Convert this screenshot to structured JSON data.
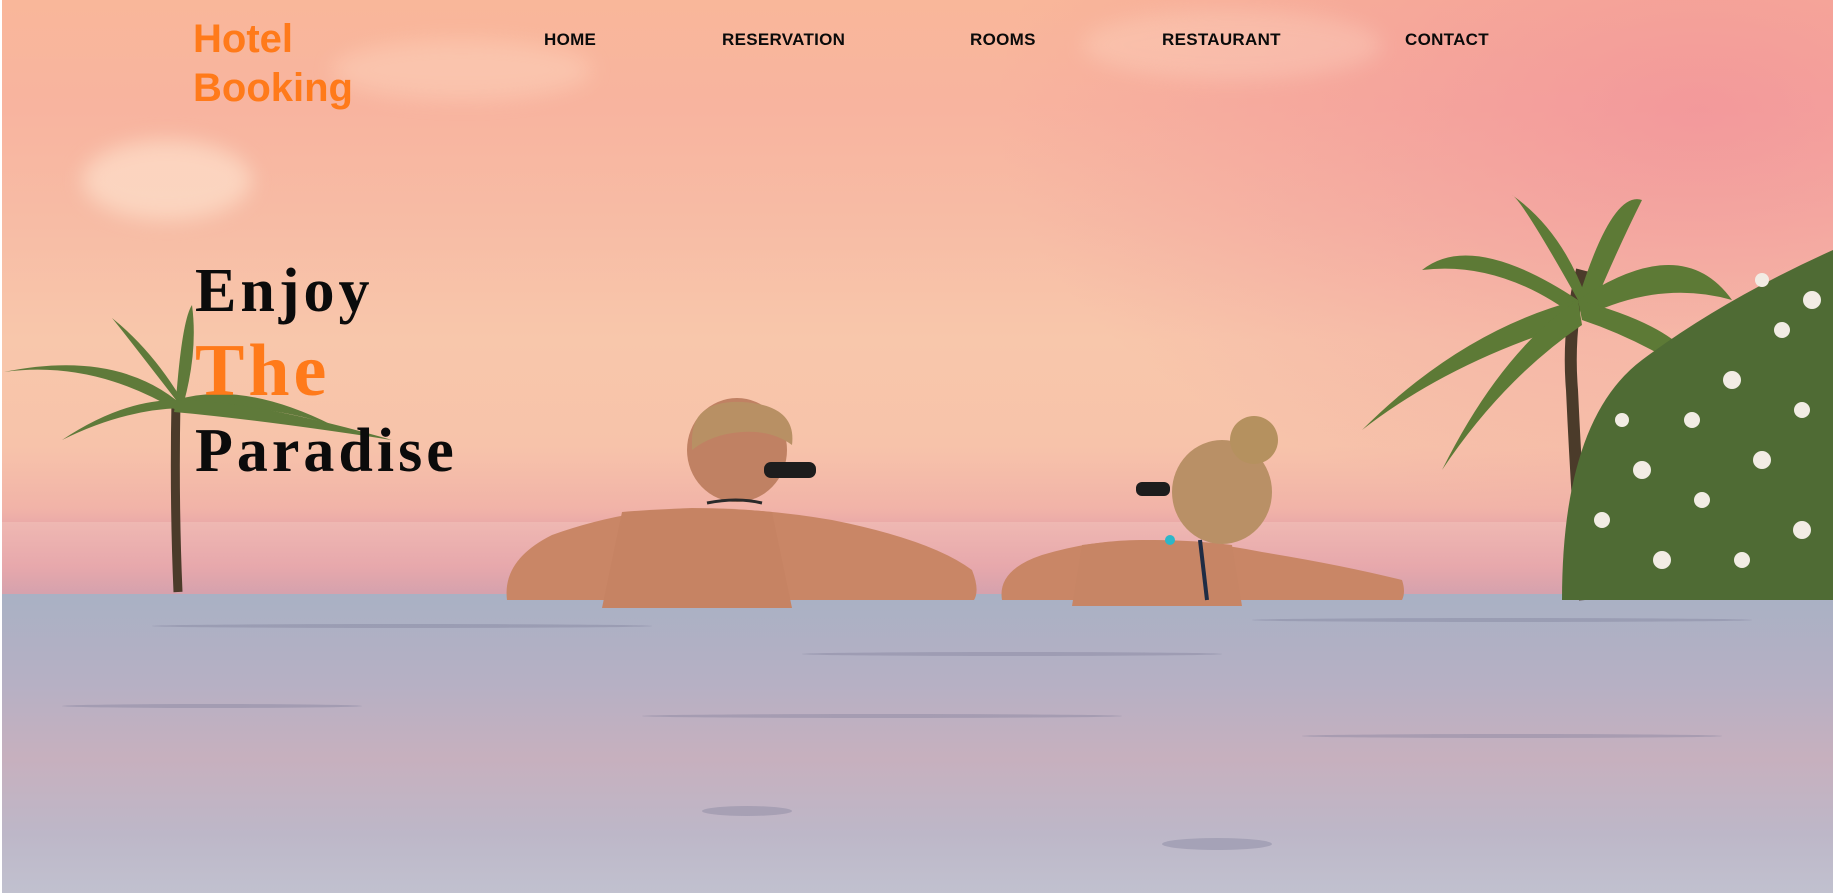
{
  "brand": {
    "line1": "Hotel",
    "line2": "Booking",
    "color": "#ff7a1a"
  },
  "nav": {
    "items": [
      {
        "label": "HOME"
      },
      {
        "label": "RESERVATION"
      },
      {
        "label": "ROOMS"
      },
      {
        "label": "RESTAURANT"
      },
      {
        "label": "CONTACT"
      }
    ]
  },
  "hero": {
    "line1": "Enjoy",
    "line2": "The",
    "line3": "Paradise",
    "accent_color": "#ff7a1a",
    "image": "couple-in-infinity-pool-at-sunset"
  }
}
